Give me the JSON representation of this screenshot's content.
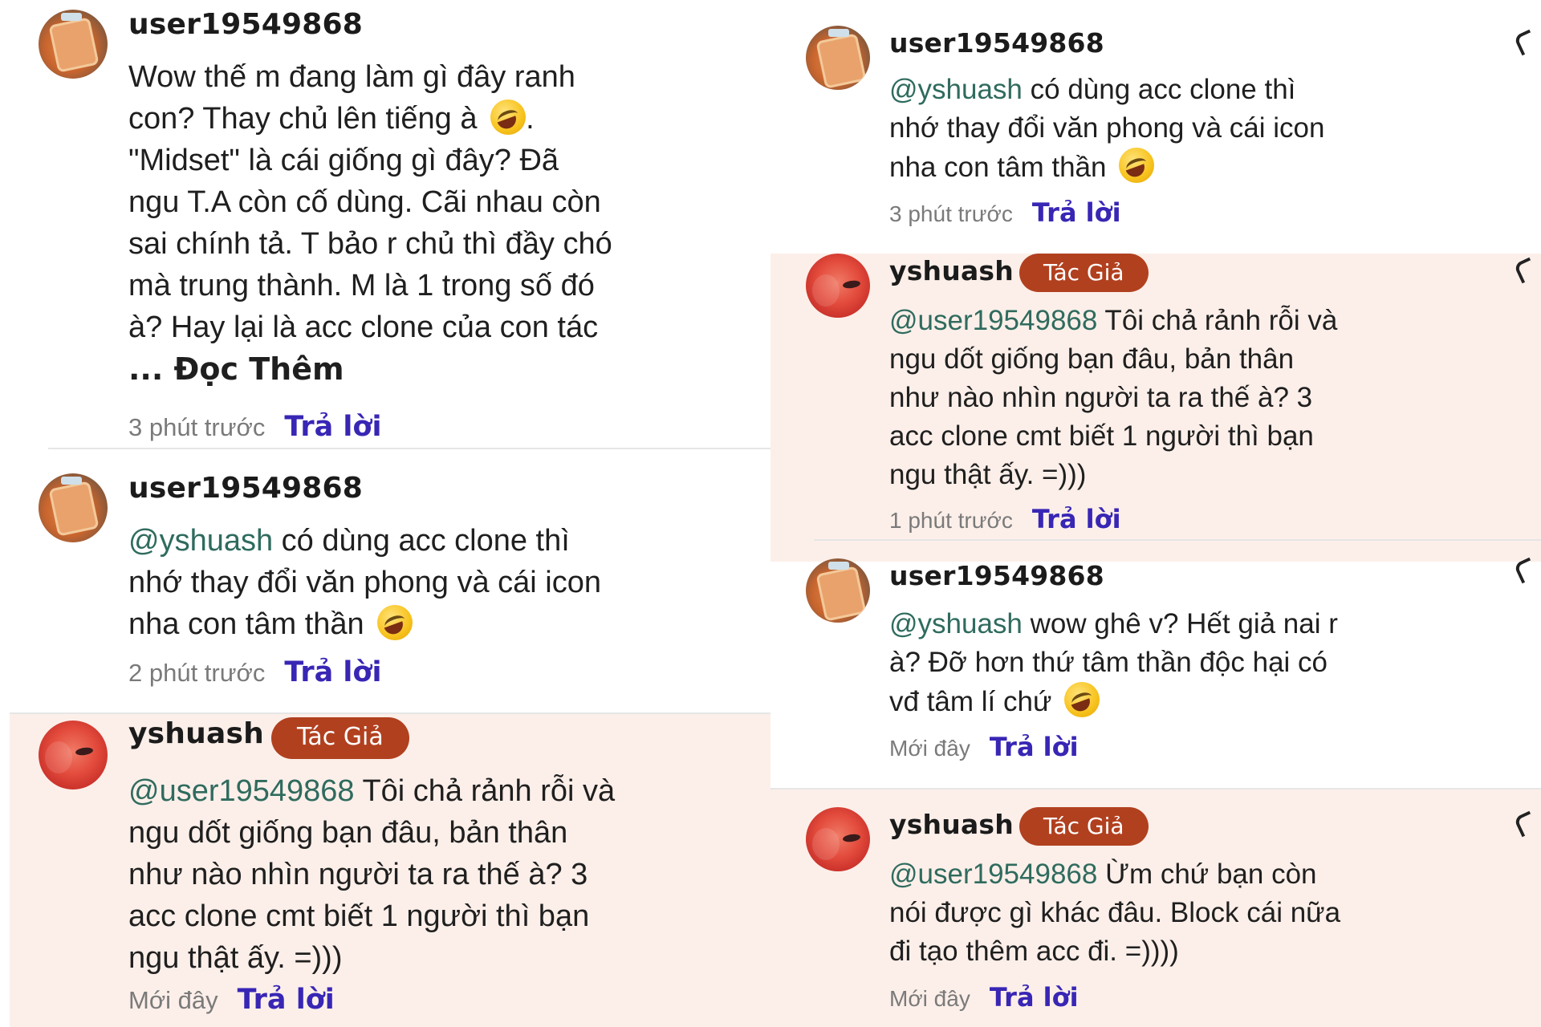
{
  "left": {
    "c1": {
      "username": "user19549868",
      "text_lines": [
        "Wow thế m đang làm gì đây ranh",
        "con? Thay chủ lên tiếng à",
        "\"Midset\" là cái giống gì đây? Đã",
        "ngu T.A còn cố dùng. Cãi nhau còn",
        "sai chính tả. T bảo r chủ thì đầy chó",
        "mà trung thành. M là 1 trong số đó",
        "à? Hay lại là acc clone của con tác"
      ],
      "after_emoji": ".",
      "read_more": "... Đọc Thêm",
      "time": "3 phút trước",
      "reply": "Trả lời"
    },
    "c2": {
      "username": "user19549868",
      "mention": "@yshuash",
      "text_lines": [
        " có dùng acc clone thì",
        "nhớ thay đổi văn phong và cái icon",
        "nha con tâm thần"
      ],
      "time": "2 phút trước",
      "reply": "Trả lời"
    },
    "c3": {
      "username": "yshuash",
      "badge": "Tác Giả",
      "mention": "@user19549868",
      "text_lines": [
        " Tôi chả rảnh rỗi và",
        "ngu dốt giống bạn đâu, bản thân",
        "như nào nhìn người ta ra thế à? 3",
        "acc clone cmt biết 1 người thì bạn",
        "ngu thật ấy. =)))"
      ],
      "time": "Mới đây",
      "reply": "Trả lời"
    }
  },
  "right": {
    "c1": {
      "username": "user19549868",
      "mention": "@yshuash",
      "text_lines": [
        " có dùng acc clone thì",
        "nhớ thay đổi văn phong và cái icon",
        "nha con tâm thần"
      ],
      "time": "3 phút trước",
      "reply": "Trả lời"
    },
    "c2": {
      "username": "yshuash",
      "badge": "Tác Giả",
      "mention": "@user19549868",
      "text_lines": [
        " Tôi chả rảnh rỗi và",
        "ngu dốt giống bạn đâu, bản thân",
        "như nào nhìn người ta ra thế à? 3",
        "acc clone cmt biết 1 người thì bạn",
        "ngu thật ấy. =)))"
      ],
      "time": "1 phút trước",
      "reply": "Trả lời"
    },
    "c3": {
      "username": "user19549868",
      "mention": "@yshuash",
      "text_lines": [
        " wow ghê v? Hết giả nai r",
        "à? Đỡ hơn thứ tâm thần độc hại có",
        "vđ tâm lí chứ"
      ],
      "time": "Mới đây",
      "reply": "Trả lời"
    },
    "c4": {
      "username": "yshuash",
      "badge": "Tác Giả",
      "mention": "@user19549868",
      "text_lines": [
        " Ừm chứ bạn còn",
        "nói được gì khác đâu. Block cái nữa",
        "đi tạo thêm acc đi. =))))"
      ],
      "time": "Mới đây",
      "reply": "Trả lời"
    }
  },
  "icons": {
    "emoji": "rolling-on-floor-laughing",
    "more": "more-options"
  },
  "colors": {
    "author_bg": "#fcefe9",
    "badge": "#b1401f",
    "mention": "#2f6b5e",
    "reply": "#3826b5",
    "time": "#7a7a7a"
  }
}
